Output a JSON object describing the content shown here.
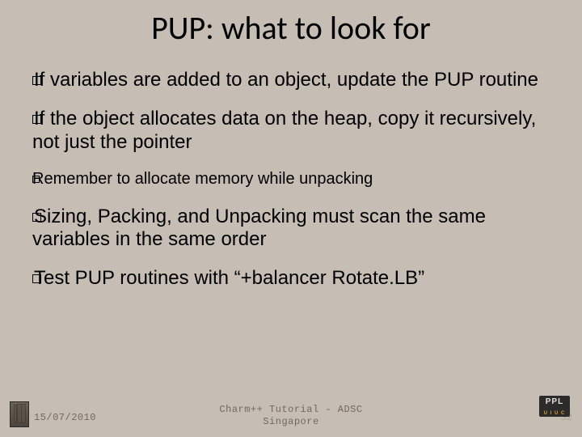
{
  "title": "PUP: what to look for",
  "items": [
    {
      "text": "If variables are added to an object, update the PUP routine",
      "size": "large"
    },
    {
      "text": "If the object allocates data on the heap, copy it recursively, not just the pointer",
      "size": "large"
    },
    {
      "text": "Remember to allocate memory while unpacking",
      "size": "small"
    },
    {
      "text": "Sizing, Packing, and Unpacking must scan the same variables in the same order",
      "size": "large"
    },
    {
      "text": "Test PUP routines with “+balancer Rotate.LB”",
      "size": "large"
    }
  ],
  "footer": {
    "date": "15/07/2010",
    "center_line1": "Charm++ Tutorial - ADSC",
    "center_line2": "Singapore",
    "page_num": "32"
  },
  "logo_right": {
    "top": "PPL",
    "bottom": "U I U C"
  }
}
